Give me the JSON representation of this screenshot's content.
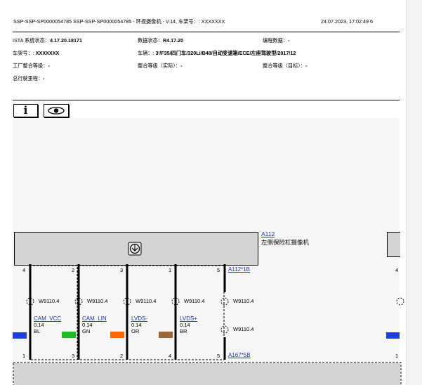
{
  "header": {
    "title": "SSP-SSP-SP0000054785 SSP-SSP-SP0000054785 - 环视摄像机 - V.14, 车架号：: XXXXXXX",
    "datetime": "24.07.2023, 17:02:49 6"
  },
  "info": {
    "ista_label": "ISTA 系统状态：",
    "ista_value": "4.17.20.18171",
    "data_label": "数据状态：",
    "data_value": "R4.17.20",
    "prog_label": "编程数据：",
    "prog_value": "-",
    "vin_label": "车架号：:",
    "vin_value": "XXXXXXX",
    "vehicle_label": "车辆：:",
    "vehicle_value": "3'/F35/四门车/320Li/B48/自动变速箱/ECE/左座驾驶型/2017/12",
    "factory_label": "工厂整合等级：",
    "factory_value": "-",
    "actual_label": "整合等级（实际）：",
    "actual_value": "-",
    "target_label": "整合等级（目标）：",
    "target_value": "-",
    "mileage_label": "总行驶里程：",
    "mileage_value": "-"
  },
  "toolbar": {
    "info_label": "i"
  },
  "diagram": {
    "component_id": "A112",
    "component_name": "左侧保险杠摄像机",
    "top_connector": "A112*1B",
    "bottom_connector": "A167*5B",
    "wire_code": "W9110.4",
    "pins_top": [
      "4",
      "2",
      "3",
      "1",
      "5"
    ],
    "pins_bottom": [
      "1",
      "3",
      "2",
      "4",
      "5"
    ],
    "right_pin_top": "4",
    "right_pin_bottom": "1",
    "signals": [
      {
        "name": "CAM_VCC",
        "size": "0.14",
        "color_code": "BL",
        "swatch": "#22bb22"
      },
      {
        "name": "CAM_LIN",
        "size": "0.14",
        "color_code": "GN",
        "swatch": "#ff6600"
      },
      {
        "name": "LVDS-",
        "size": "0.14",
        "color_code": "OR",
        "swatch": "#99663a"
      },
      {
        "name": "LVDS+",
        "size": "0.14",
        "color_code": "BR",
        "swatch": ""
      }
    ],
    "colors": {
      "blue_wire": "#1f3fdc",
      "component_fill": "#d4d4d4",
      "link": "#1a33c8"
    }
  }
}
